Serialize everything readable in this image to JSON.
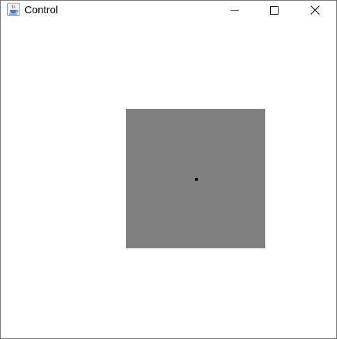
{
  "window": {
    "title": "Control",
    "icon": "java-coffee-cup-icon",
    "controls": [
      "minimize-icon",
      "maximize-icon",
      "close-icon"
    ]
  },
  "canvas": {
    "background": "#ffffff",
    "panel_color": "#808080",
    "dot_color": "#000000"
  }
}
